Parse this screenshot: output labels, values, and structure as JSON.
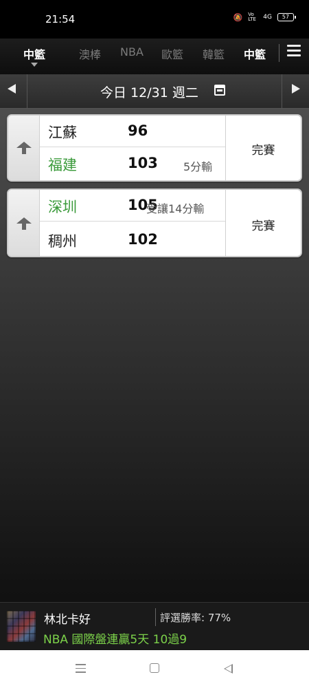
{
  "status_bar": {
    "time": "21:54",
    "signal_label": "4G",
    "volte_label": "Vo LTE",
    "battery": "57"
  },
  "tabs": [
    {
      "label": "中籃",
      "active": true
    },
    {
      "label": "澳棒",
      "active": false
    },
    {
      "label": "NBA",
      "active": false
    },
    {
      "label": "歐籃",
      "active": false
    },
    {
      "label": "韓籃",
      "active": false
    },
    {
      "label": "中籃",
      "active": false
    }
  ],
  "date_bar": {
    "label": "今日 12/31 週二",
    "icon": "calendar-icon"
  },
  "games": [
    {
      "away_team": "江蘇",
      "away_score": "96",
      "home_team": "福建",
      "home_score": "103",
      "note": "5分輸",
      "status": "完賽"
    },
    {
      "away_team": "深圳",
      "away_score": "105",
      "home_team": "稠州",
      "home_score": "102",
      "note": "受讓14分輸",
      "status": "完賽"
    }
  ],
  "banner": {
    "name": "林北卡好",
    "win_rate": "評選勝率: 77%",
    "promo": "NBA 國際盤連贏5天 10過9"
  },
  "colors": {
    "home_team_green": "#3a9a3a",
    "promo_green": "#7cd24a",
    "accent_white": "#ffffff"
  }
}
